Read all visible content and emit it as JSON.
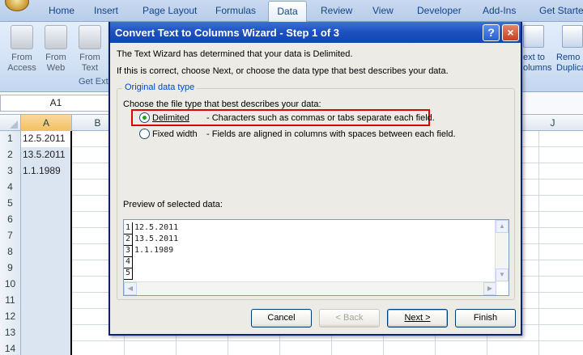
{
  "ribbon": {
    "tabs": [
      "Home",
      "Insert",
      "Page Layout",
      "Formulas",
      "Data",
      "Review",
      "View",
      "Developer",
      "Add-Ins",
      "Get Started"
    ],
    "active_tab": "Data",
    "buttons": [
      {
        "line1": "From",
        "line2": "Access"
      },
      {
        "line1": "From",
        "line2": "Web"
      },
      {
        "line1": "From",
        "line2": "Text"
      }
    ],
    "group_label": "Get Ext",
    "right_buttons": [
      {
        "line1": "ext to",
        "line2": "olumns"
      },
      {
        "line1": "Remo",
        "line2": "Duplica"
      }
    ]
  },
  "formula_bar": {
    "name_box": "A1"
  },
  "grid": {
    "columns": [
      "A",
      "B",
      "J"
    ],
    "rows": [
      {
        "num": "1",
        "a": "12.5.2011"
      },
      {
        "num": "2",
        "a": "13.5.2011"
      },
      {
        "num": "3",
        "a": "1.1.1989"
      },
      {
        "num": "4",
        "a": ""
      },
      {
        "num": "5",
        "a": ""
      },
      {
        "num": "6",
        "a": ""
      },
      {
        "num": "7",
        "a": ""
      },
      {
        "num": "8",
        "a": ""
      },
      {
        "num": "9",
        "a": ""
      },
      {
        "num": "10",
        "a": ""
      },
      {
        "num": "11",
        "a": ""
      },
      {
        "num": "12",
        "a": ""
      },
      {
        "num": "13",
        "a": ""
      },
      {
        "num": "14",
        "a": ""
      }
    ]
  },
  "dialog": {
    "title": "Convert Text to Columns Wizard - Step 1 of 3",
    "help_glyph": "?",
    "close_glyph": "×",
    "intro1": "The Text Wizard has determined that your data is Delimited.",
    "intro2": "If this is correct, choose Next, or choose the data type that best describes your data.",
    "group_label": "Original data type",
    "choose_label": "Choose the file type that best describes your data:",
    "options": [
      {
        "label": "Delimited",
        "desc": "- Characters such as commas or tabs separate each field.",
        "checked": true
      },
      {
        "label": "Fixed width",
        "desc": "- Fields are aligned in columns with spaces between each field.",
        "checked": false
      }
    ],
    "preview_label": "Preview of selected data:",
    "preview_lines": [
      {
        "num": "1",
        "text": "12.5.2011"
      },
      {
        "num": "2",
        "text": "13.5.2011"
      },
      {
        "num": "3",
        "text": "1.1.1989"
      },
      {
        "num": "4",
        "text": ""
      },
      {
        "num": "5",
        "text": ""
      }
    ],
    "buttons": {
      "cancel": "Cancel",
      "back": "< Back",
      "next": "Next >",
      "finish": "Finish"
    }
  },
  "colors": {
    "title_bar": "#1d50bd",
    "highlight": "#e00000",
    "dialog_bg": "#ecebe6"
  }
}
